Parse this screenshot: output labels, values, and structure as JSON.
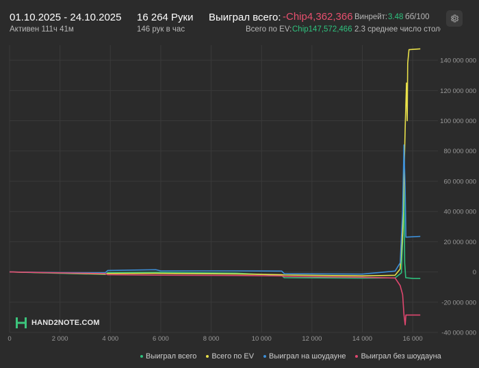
{
  "header": {
    "date_range": "01.10.2025 - 24.10.2025",
    "active": "Активен 111ч 41м",
    "hands": "16 264 Руки",
    "hands_per_hour": "146 рук в час",
    "won_total_label": "Выиграл всего:",
    "won_total_value": "-Chip4,362,366",
    "ev_label": "Всего по EV:",
    "ev_value": "Chip147,572,466",
    "winrate_label": "Винрейт:",
    "winrate_value": "3.48",
    "winrate_unit": "бб/100",
    "avg_tables": "2.3 среднее число столо"
  },
  "logo": {
    "text": "HAND2NOTE.COM"
  },
  "colors": {
    "won_total": "#2ec27e",
    "ev": "#e8e04a",
    "showdown": "#3d8fd8",
    "non_showdown": "#e0476f",
    "grid": "#3a3a3a",
    "axis_text": "#9a9a9a"
  },
  "chart_data": {
    "type": "line",
    "x_ticks": [
      0,
      2000,
      4000,
      6000,
      8000,
      10000,
      12000,
      14000,
      16000
    ],
    "x_tick_labels": [
      "0",
      "2 000",
      "4 000",
      "6 000",
      "8 000",
      "10 000",
      "12 000",
      "14 000",
      "16 000"
    ],
    "y_ticks": [
      -40000000,
      -20000000,
      0,
      20000000,
      40000000,
      60000000,
      80000000,
      100000000,
      120000000,
      140000000
    ],
    "y_tick_labels": [
      "-40 000 000",
      "-20 000 000",
      "0",
      "20 000 000",
      "40 000 000",
      "60 000 000",
      "80 000 000",
      "100 000 000",
      "120 000 000",
      "140 000 000"
    ],
    "xlim": [
      0,
      17000
    ],
    "ylim": [
      -40000000,
      150000000
    ],
    "series": [
      {
        "name": "Выиграл всего",
        "color_key": "won_total",
        "points": [
          [
            0,
            0
          ],
          [
            2000,
            -900000
          ],
          [
            3800,
            -1600000
          ],
          [
            3900,
            -400000
          ],
          [
            5800,
            -300000
          ],
          [
            9000,
            -800000
          ],
          [
            10800,
            -2300000
          ],
          [
            10900,
            -3800000
          ],
          [
            14000,
            -4100000
          ],
          [
            15300,
            -3900000
          ],
          [
            15550,
            -600000
          ],
          [
            15620,
            30000000
          ],
          [
            15650,
            65000000
          ],
          [
            15680,
            6000000
          ],
          [
            15720,
            -3800000
          ],
          [
            16000,
            -4300000
          ],
          [
            16300,
            -4362366
          ]
        ]
      },
      {
        "name": "Всего по EV",
        "color_key": "ev",
        "points": [
          [
            0,
            0
          ],
          [
            2000,
            -700000
          ],
          [
            3800,
            -1400000
          ],
          [
            3900,
            -1000000
          ],
          [
            5800,
            -900000
          ],
          [
            9000,
            -1300000
          ],
          [
            10800,
            -1800000
          ],
          [
            10900,
            -2000000
          ],
          [
            14000,
            -2600000
          ],
          [
            15300,
            -2200000
          ],
          [
            15500,
            2000000
          ],
          [
            15600,
            25000000
          ],
          [
            15650,
            60000000
          ],
          [
            15700,
            95000000
          ],
          [
            15750,
            125000000
          ],
          [
            15780,
            100000000
          ],
          [
            15800,
            138000000
          ],
          [
            15850,
            147000000
          ],
          [
            16300,
            147572466
          ]
        ]
      },
      {
        "name": "Выиграл на шоудауне",
        "color_key": "showdown",
        "points": [
          [
            0,
            0
          ],
          [
            2000,
            -400000
          ],
          [
            3800,
            -500000
          ],
          [
            3900,
            1000000
          ],
          [
            5800,
            1500000
          ],
          [
            6000,
            700000
          ],
          [
            9000,
            700000
          ],
          [
            10800,
            600000
          ],
          [
            10900,
            -1200000
          ],
          [
            14000,
            -1400000
          ],
          [
            15300,
            600000
          ],
          [
            15500,
            6000000
          ],
          [
            15600,
            40000000
          ],
          [
            15650,
            84000000
          ],
          [
            15700,
            55000000
          ],
          [
            15730,
            23000000
          ],
          [
            16300,
            23500000
          ]
        ]
      },
      {
        "name": "Выиграл без шоудауна",
        "color_key": "non_showdown",
        "points": [
          [
            0,
            0
          ],
          [
            2000,
            -600000
          ],
          [
            3800,
            -1100000
          ],
          [
            3900,
            -1800000
          ],
          [
            5800,
            -2100000
          ],
          [
            9000,
            -2300000
          ],
          [
            10800,
            -2600000
          ],
          [
            10900,
            -3000000
          ],
          [
            14000,
            -3500000
          ],
          [
            15300,
            -4000000
          ],
          [
            15500,
            -9000000
          ],
          [
            15600,
            -15000000
          ],
          [
            15650,
            -28000000
          ],
          [
            15700,
            -35000000
          ],
          [
            15730,
            -28500000
          ],
          [
            16300,
            -28500000
          ]
        ]
      }
    ]
  }
}
